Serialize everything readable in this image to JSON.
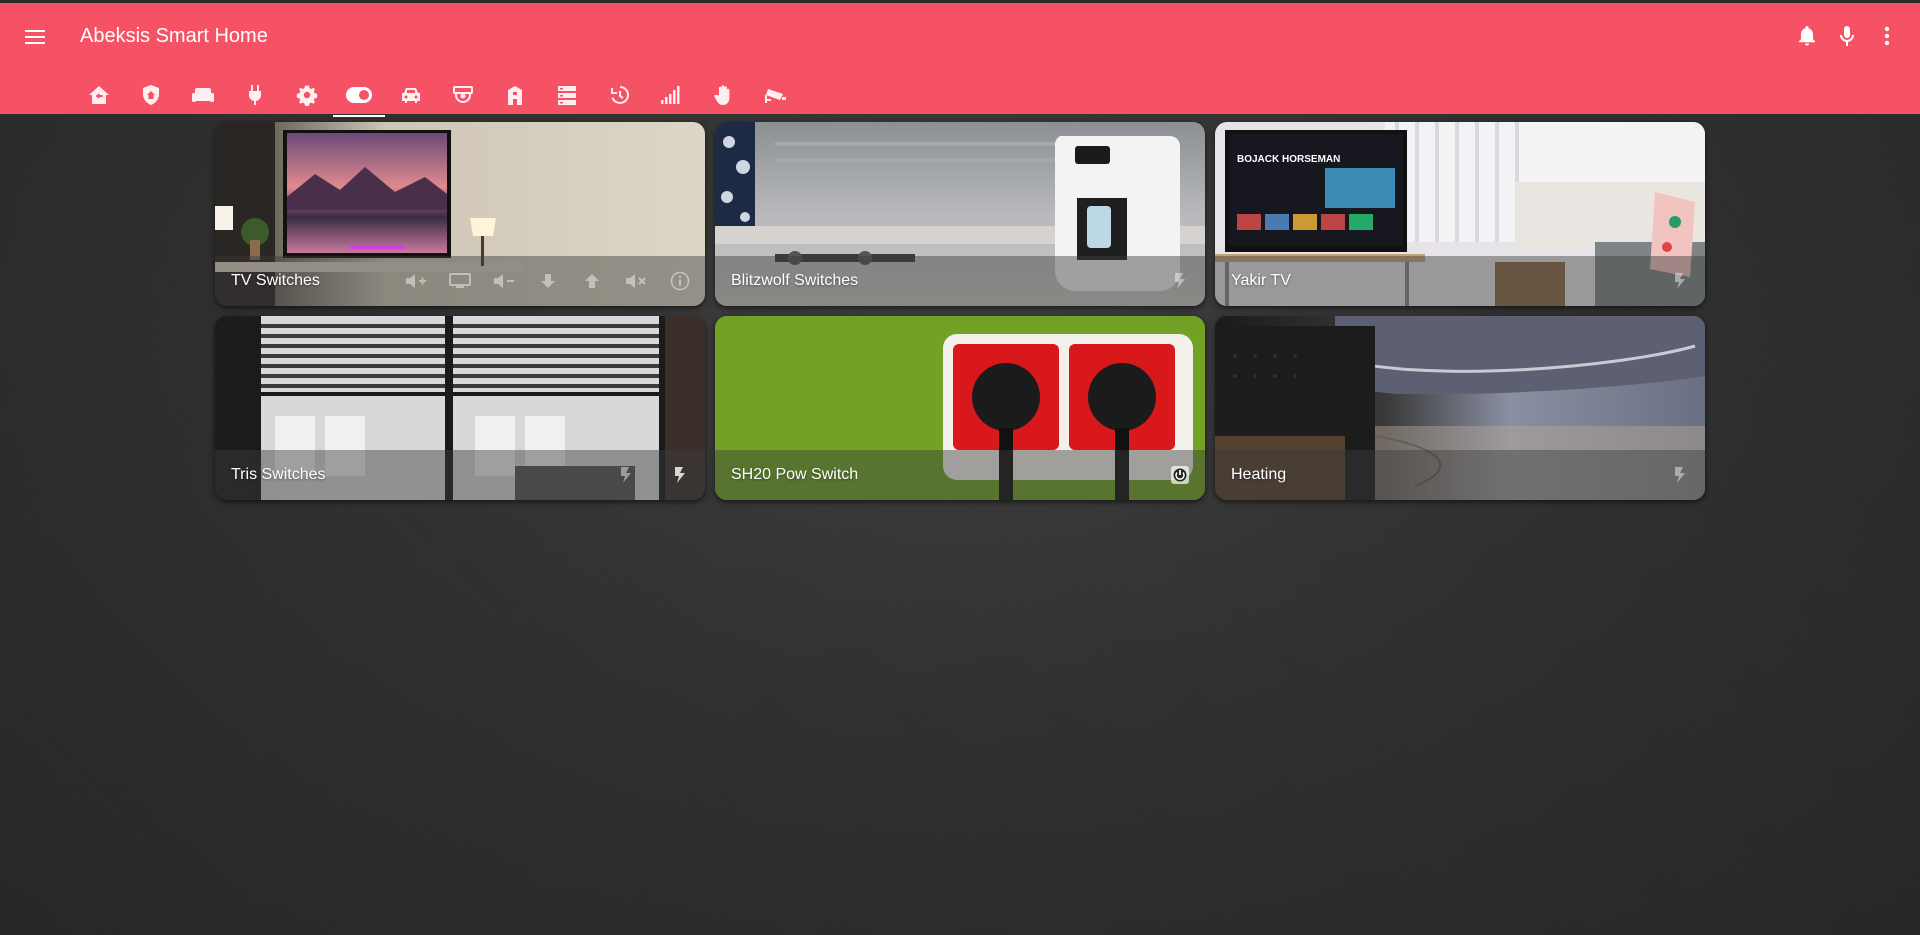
{
  "app": {
    "title": "Abeksis Smart Home"
  },
  "toolbar_icons": [
    "menu-icon",
    "bell-icon",
    "microphone-icon",
    "more-vertical-icon"
  ],
  "tabs": [
    {
      "icon": "home-import-icon"
    },
    {
      "icon": "shield-home-icon"
    },
    {
      "icon": "sofa-icon"
    },
    {
      "icon": "power-plug-icon"
    },
    {
      "icon": "gear-icon"
    },
    {
      "icon": "toggle-switch-icon",
      "active": true
    },
    {
      "icon": "car-icon"
    },
    {
      "icon": "cctv-camera-icon"
    },
    {
      "icon": "doorway-icon"
    },
    {
      "icon": "server-icon"
    },
    {
      "icon": "history-icon"
    },
    {
      "icon": "signal-bars-icon"
    },
    {
      "icon": "hand-icon"
    },
    {
      "icon": "security-camera-icon"
    }
  ],
  "cards": [
    {
      "title": "TV Switches",
      "controls": [
        "volume-up-icon",
        "input-icon",
        "volume-down-icon",
        "channel-down-icon",
        "channel-up-icon",
        "mute-icon",
        "info-icon"
      ]
    },
    {
      "title": "Blitzwolf Switches",
      "controls": [
        "flash-icon"
      ]
    },
    {
      "title": "Yakir TV",
      "controls": [
        "flash-icon"
      ]
    },
    {
      "title": "Tris Switches",
      "controls": [
        "flash-icon",
        "flash-icon"
      ]
    },
    {
      "title": "SH20 Pow Switch",
      "controls": [
        "power-icon"
      ]
    },
    {
      "title": "Heating",
      "controls": [
        "flash-icon"
      ]
    }
  ],
  "colors": {
    "header": "#f55266",
    "background": "#303030"
  }
}
